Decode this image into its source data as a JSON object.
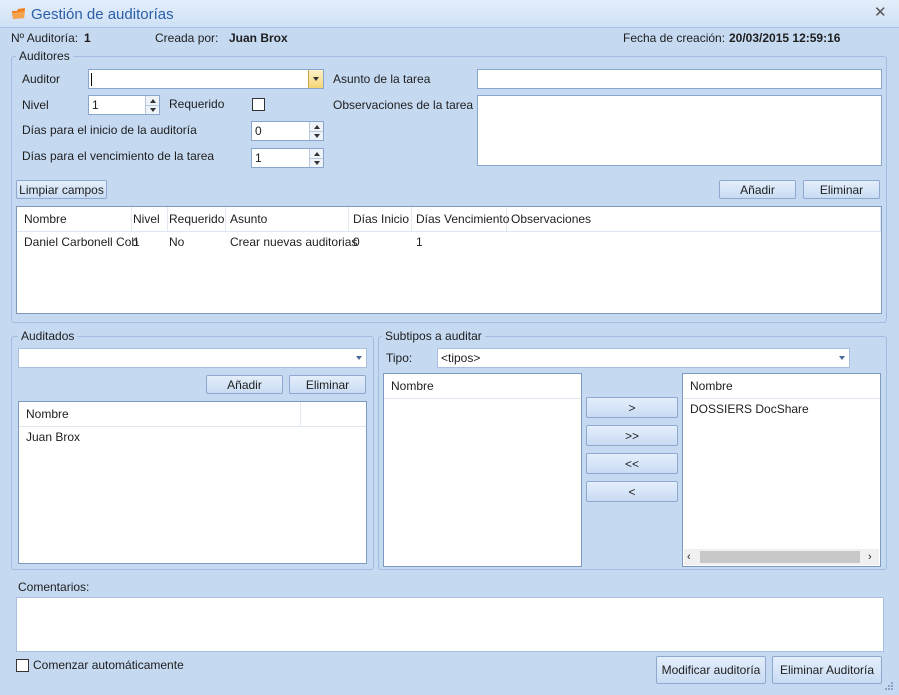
{
  "window": {
    "title": "Gestión de auditorías"
  },
  "header": {
    "audit_no_label": "Nº Auditoría:",
    "audit_no_value": "1",
    "created_by_label": "Creada por:",
    "created_by_value": "Juan Brox",
    "created_date_label": "Fecha de creación:",
    "created_date_value": "20/03/2015 12:59:16"
  },
  "auditores": {
    "group_title": "Auditores",
    "auditor_label": "Auditor",
    "auditor_value": "",
    "nivel_label": "Nivel",
    "nivel_value": "1",
    "requerido_label": "Requerido",
    "dias_inicio_label": "Días para el inicio de la auditoría",
    "dias_inicio_value": "0",
    "dias_venc_label": "Días para el vencimiento de la tarea",
    "dias_venc_value": "1",
    "asunto_label": "Asunto de la tarea",
    "asunto_value": "",
    "observaciones_label": "Observaciones de la tarea",
    "observaciones_value": "",
    "limpiar_label": "Limpiar campos",
    "anadir_label": "Añadir",
    "eliminar_label": "Eliminar",
    "table": {
      "columns": [
        "Nombre",
        "Nivel",
        "Requerido",
        "Asunto",
        "Días Inicio",
        "Días Vencimiento",
        "Observaciones"
      ],
      "rows": [
        [
          "Daniel Carbonell Cob",
          "1",
          "No",
          "Crear nuevas auditorias",
          "0",
          "1",
          ""
        ]
      ]
    }
  },
  "auditados": {
    "group_title": "Auditados",
    "combo_value": "",
    "anadir_label": "Añadir",
    "eliminar_label": "Eliminar",
    "column": "Nombre",
    "rows": [
      "Juan Brox"
    ]
  },
  "subtipos": {
    "group_title": "Subtipos a auditar",
    "tipo_label": "Tipo:",
    "tipo_value": "<tipos>",
    "left_column": "Nombre",
    "left_rows": [],
    "right_column": "Nombre",
    "right_rows": [
      "DOSSIERS DocShare"
    ],
    "move_buttons": [
      ">",
      ">>",
      "<<",
      "<"
    ]
  },
  "comentarios": {
    "label": "Comentarios:",
    "value": ""
  },
  "footer": {
    "auto_start_label": "Comenzar automáticamente",
    "auto_start_checked": false,
    "modificar_label": "Modificar auditoría",
    "eliminar_label": "Eliminar Auditoría"
  },
  "colors": {
    "background": "#c5d9f1",
    "title_text": "#2b5fa6",
    "icon": "#f07e1b"
  },
  "icons": {
    "app": "folder-icon",
    "close": "close-icon"
  }
}
